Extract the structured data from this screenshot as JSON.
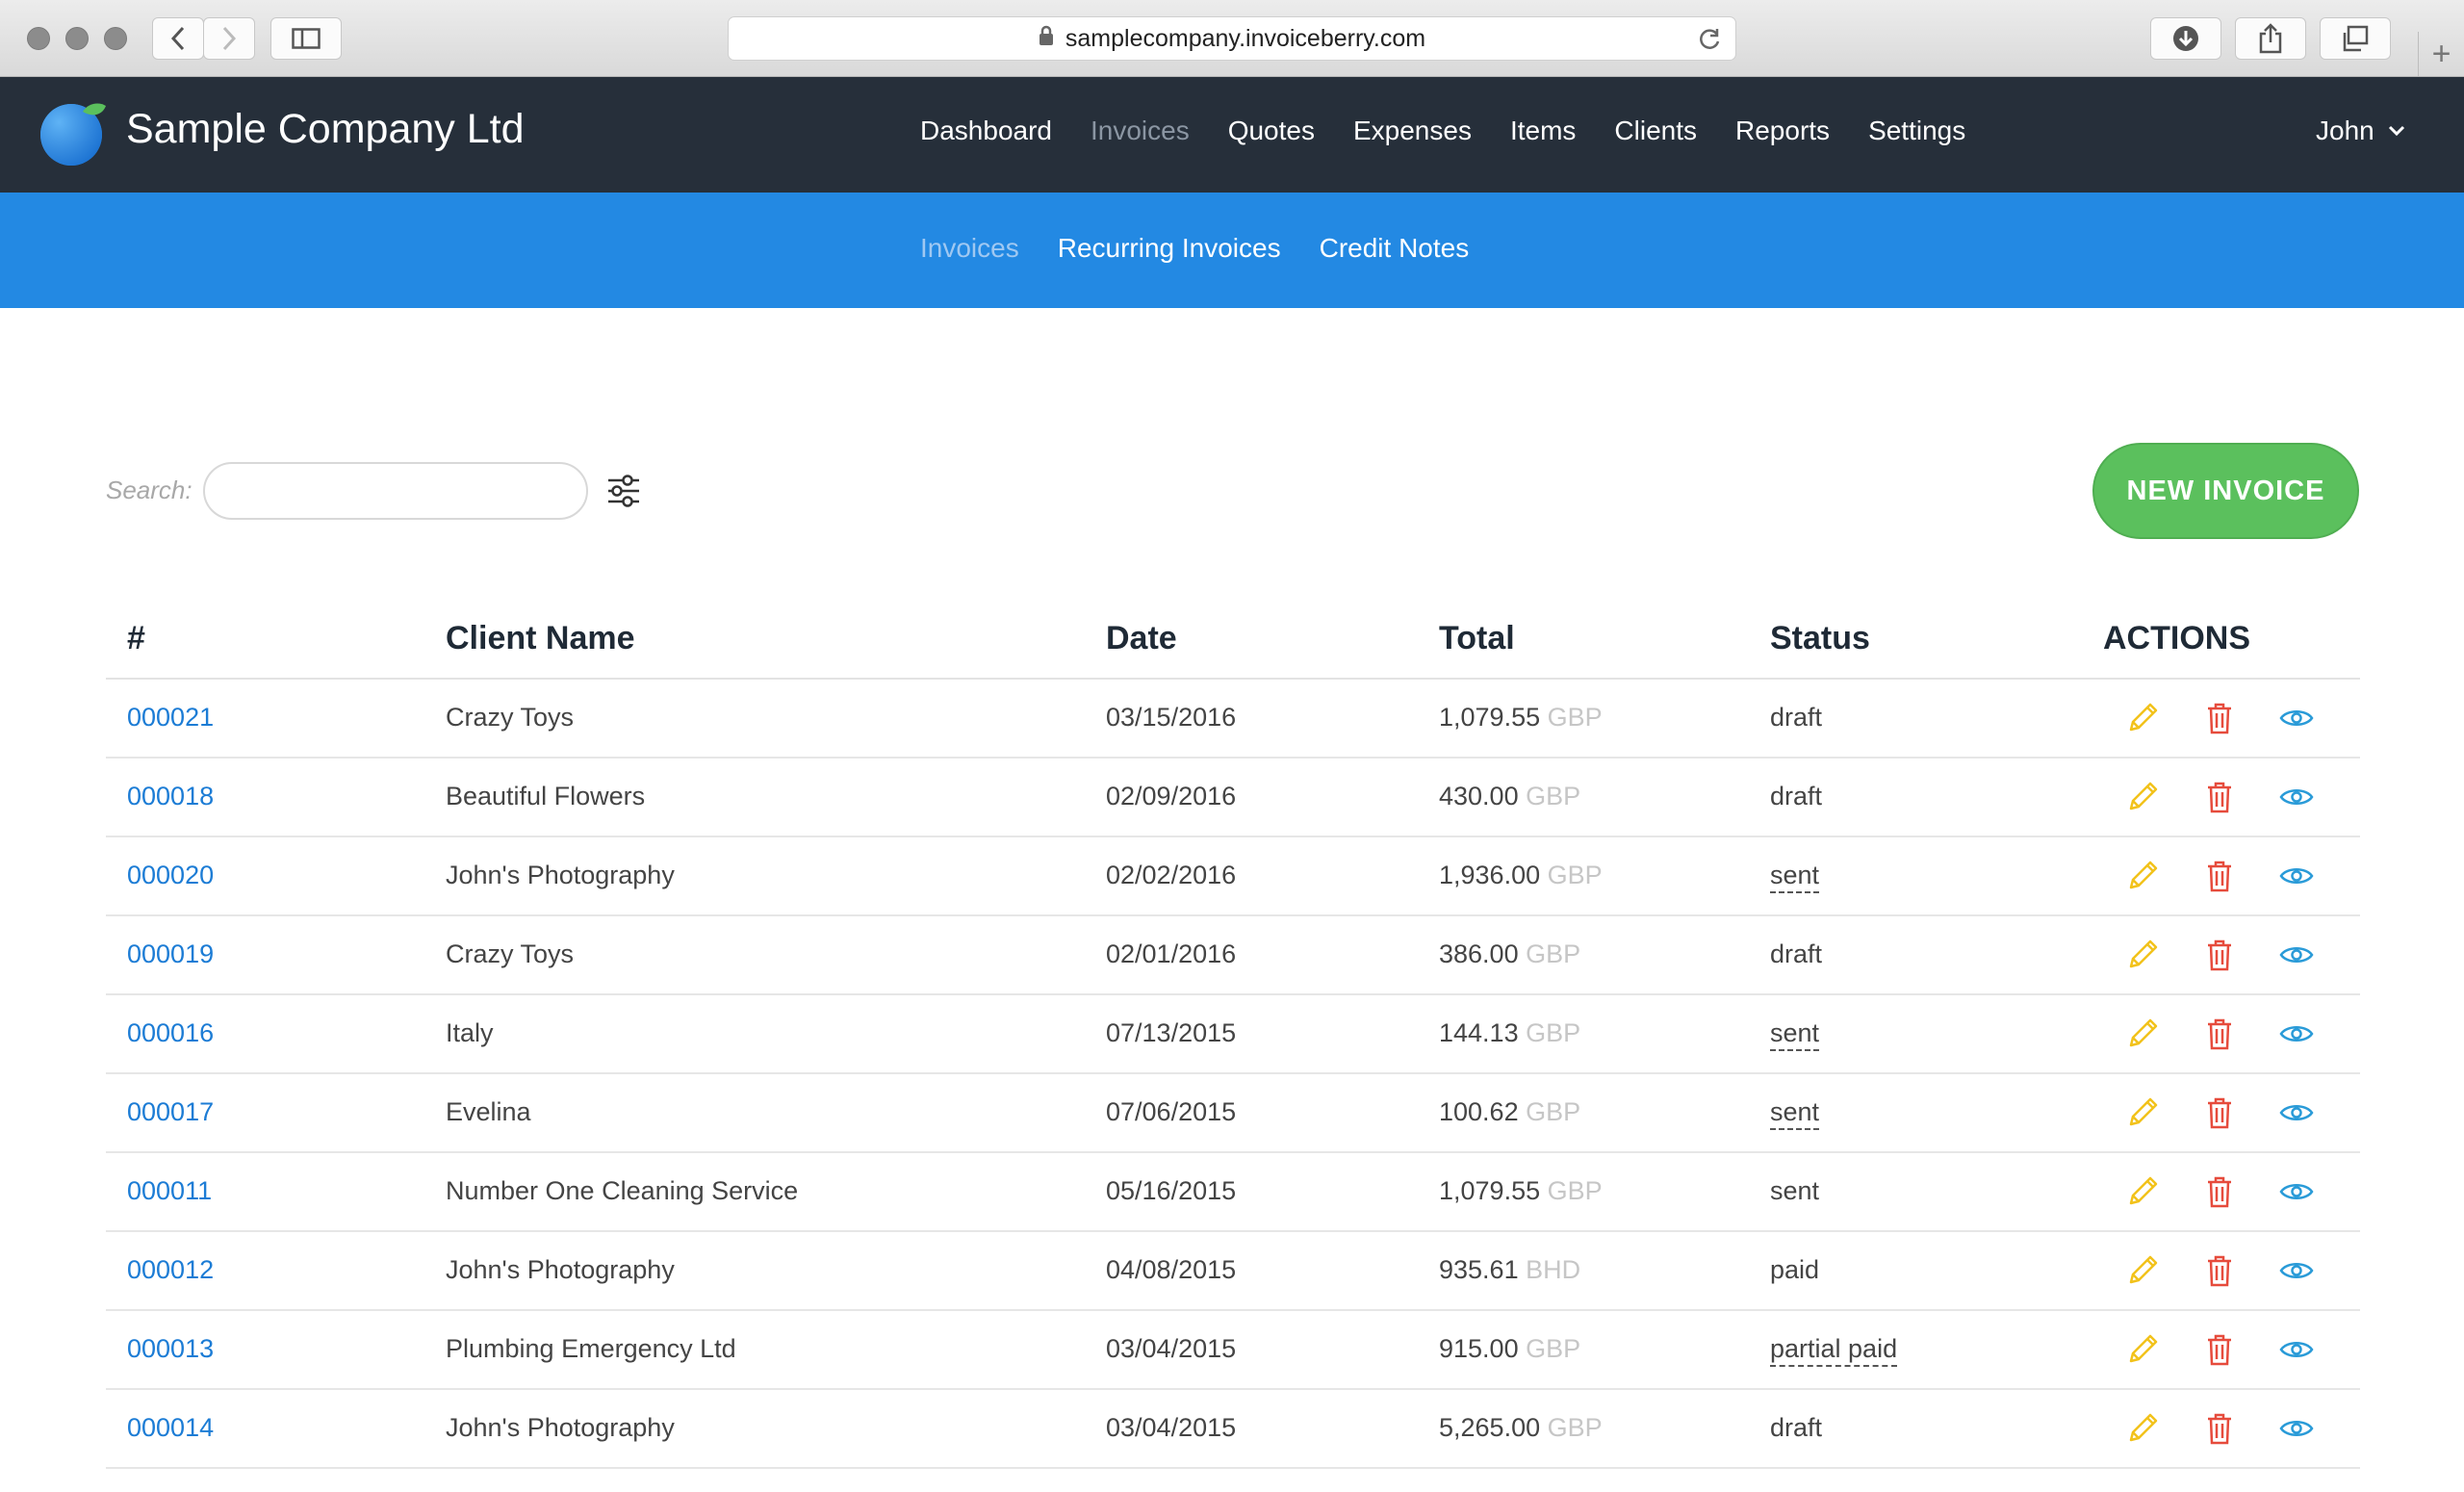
{
  "browser": {
    "url": "samplecompany.invoiceberry.com"
  },
  "app": {
    "company_name": "Sample Company Ltd",
    "nav": [
      {
        "label": "Dashboard",
        "active": false
      },
      {
        "label": "Invoices",
        "active": true
      },
      {
        "label": "Quotes",
        "active": false
      },
      {
        "label": "Expenses",
        "active": false
      },
      {
        "label": "Items",
        "active": false
      },
      {
        "label": "Clients",
        "active": false
      },
      {
        "label": "Reports",
        "active": false
      },
      {
        "label": "Settings",
        "active": false
      }
    ],
    "user": "John",
    "subnav": [
      {
        "label": "Invoices",
        "active": true
      },
      {
        "label": "Recurring Invoices",
        "active": false
      },
      {
        "label": "Credit Notes",
        "active": false
      }
    ]
  },
  "toolbar": {
    "search_label": "Search:",
    "search_value": "",
    "new_invoice_label": "NEW INVOICE"
  },
  "colors": {
    "nav_bg": "#262f3a",
    "subnav_bg": "#2389e3",
    "accent_green": "#5bc05d",
    "link_blue": "#1c7cd5",
    "edit_yellow": "#f2c21b",
    "delete_red": "#e64b3c",
    "view_blue": "#2a9bd8"
  },
  "table": {
    "headers": {
      "number": "#",
      "client": "Client Name",
      "date": "Date",
      "total": "Total",
      "status": "Status",
      "actions": "ACTIONS"
    },
    "rows": [
      {
        "number": "000021",
        "client": "Crazy Toys",
        "date": "03/15/2016",
        "amount": "1,079.55",
        "currency": "GBP",
        "status": "draft",
        "status_dotted": false
      },
      {
        "number": "000018",
        "client": "Beautiful Flowers",
        "date": "02/09/2016",
        "amount": "430.00",
        "currency": "GBP",
        "status": "draft",
        "status_dotted": false
      },
      {
        "number": "000020",
        "client": "John's Photography",
        "date": "02/02/2016",
        "amount": "1,936.00",
        "currency": "GBP",
        "status": "sent",
        "status_dotted": true
      },
      {
        "number": "000019",
        "client": "Crazy Toys",
        "date": "02/01/2016",
        "amount": "386.00",
        "currency": "GBP",
        "status": "draft",
        "status_dotted": false
      },
      {
        "number": "000016",
        "client": "Italy",
        "date": "07/13/2015",
        "amount": "144.13",
        "currency": "GBP",
        "status": "sent",
        "status_dotted": true
      },
      {
        "number": "000017",
        "client": "Evelina",
        "date": "07/06/2015",
        "amount": "100.62",
        "currency": "GBP",
        "status": "sent",
        "status_dotted": true
      },
      {
        "number": "000011",
        "client": "Number One Cleaning Service",
        "date": "05/16/2015",
        "amount": "1,079.55",
        "currency": "GBP",
        "status": "sent",
        "status_dotted": false
      },
      {
        "number": "000012",
        "client": "John's Photography",
        "date": "04/08/2015",
        "amount": "935.61",
        "currency": "BHD",
        "status": "paid",
        "status_dotted": false
      },
      {
        "number": "000013",
        "client": "Plumbing Emergency Ltd",
        "date": "03/04/2015",
        "amount": "915.00",
        "currency": "GBP",
        "status": "partial paid",
        "status_dotted": true
      },
      {
        "number": "000014",
        "client": "John's Photography",
        "date": "03/04/2015",
        "amount": "5,265.00",
        "currency": "GBP",
        "status": "draft",
        "status_dotted": false
      }
    ]
  }
}
